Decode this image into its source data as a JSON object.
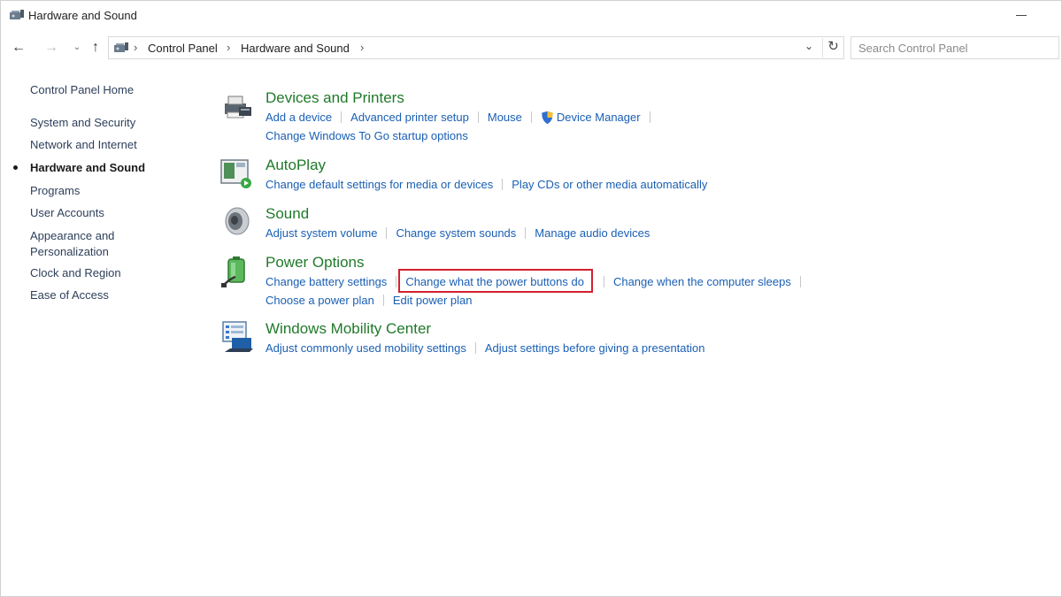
{
  "window": {
    "title": "Hardware and Sound"
  },
  "navbar": {
    "breadcrumb": [
      "Control Panel",
      "Hardware and Sound"
    ],
    "search_placeholder": "Search Control Panel"
  },
  "sidebar": {
    "items": [
      {
        "label": "Control Panel Home"
      },
      {
        "label": "System and Security"
      },
      {
        "label": "Network and Internet"
      },
      {
        "label": "Hardware and Sound",
        "active": true
      },
      {
        "label": "Programs"
      },
      {
        "label": "User Accounts"
      },
      {
        "label": "Appearance and Personalization"
      },
      {
        "label": "Clock and Region"
      },
      {
        "label": "Ease of Access"
      }
    ]
  },
  "categories": [
    {
      "title": "Devices and Printers",
      "icon": "printer-icon",
      "links": [
        "Add a device",
        "Advanced printer setup",
        "Mouse",
        "Device Manager",
        "Change Windows To Go startup options"
      ]
    },
    {
      "title": "AutoPlay",
      "icon": "autoplay-icon",
      "links": [
        "Change default settings for media or devices",
        "Play CDs or other media automatically"
      ]
    },
    {
      "title": "Sound",
      "icon": "speaker-icon",
      "links": [
        "Adjust system volume",
        "Change system sounds",
        "Manage audio devices"
      ]
    },
    {
      "title": "Power Options",
      "icon": "battery-icon",
      "links": [
        "Change battery settings",
        "Change what the power buttons do",
        "Change when the computer sleeps",
        "Choose a power plan",
        "Edit power plan"
      ],
      "highlighted_link": "Change what the power buttons do",
      "highlight_color": "#d1202f"
    },
    {
      "title": "Windows Mobility Center",
      "icon": "mobility-center-icon",
      "links": [
        "Adjust commonly used mobility settings",
        "Adjust settings before giving a presentation"
      ]
    }
  ],
  "colors": {
    "category_title": "#1f7a2a",
    "task_link": "#1a5fb4",
    "highlight": "#d1202f"
  }
}
